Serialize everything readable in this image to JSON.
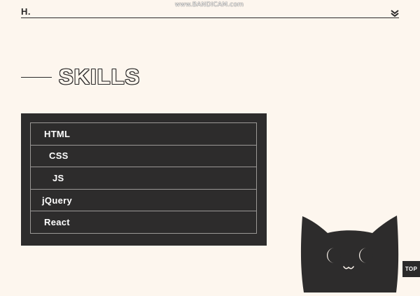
{
  "watermark": {
    "text": "www.BANDICAM.com"
  },
  "header": {
    "logo": "H.",
    "menu_icon": "chevron-down-icon"
  },
  "section": {
    "title": "SKILLS"
  },
  "skills": [
    {
      "label": "HTML"
    },
    {
      "label": "CSS"
    },
    {
      "label": "JS"
    },
    {
      "label": "jQuery"
    },
    {
      "label": "React"
    }
  ],
  "illustration": {
    "name": "cat-illustration"
  },
  "top_button": {
    "label": "TOP"
  },
  "colors": {
    "background": "#fdf6ee",
    "dark": "#2b2a2a",
    "panel": "#2d2c2c",
    "panel_border": "#9a9896",
    "text_light": "#ffffff"
  }
}
